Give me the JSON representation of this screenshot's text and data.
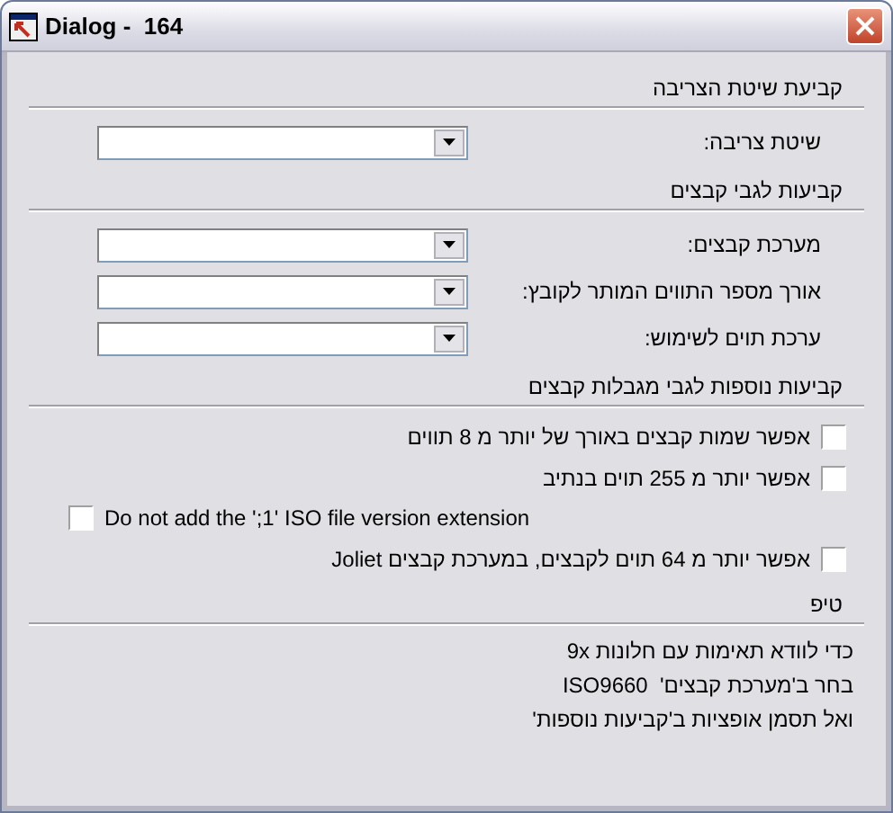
{
  "window": {
    "title": "Dialog -  164"
  },
  "sections": [
    {
      "heading": "קביעת שיטת הצריבה",
      "kind": "combos",
      "items": [
        {
          "label": "שיטת צריבה:"
        }
      ]
    },
    {
      "heading": "קביעות לגבי קבצים",
      "kind": "combos",
      "items": [
        {
          "label": "מערכת קבצים:"
        },
        {
          "label": "אורך מספר התווים המותר לקובץ:"
        },
        {
          "label": "ערכת תוים לשימוש:"
        }
      ]
    },
    {
      "heading": "קביעות נוספות לגבי מגבלות קבצים",
      "kind": "checks",
      "items": [
        {
          "label": "אפשר שמות קבצים באורך של יותר מ 8 תווים",
          "checked": false,
          "kind": "rtl"
        },
        {
          "label": "אפשר יותר מ 255 תוים בנתיב",
          "checked": false,
          "kind": "rtl"
        },
        {
          "label": "Do not add the ';1' ISO file version extension",
          "checked": false,
          "kind": "ltr"
        },
        {
          "label": "אפשר יותר מ 64 תוים לקבצים, במערכת קבצים Joliet",
          "checked": false,
          "kind": "rtl"
        }
      ]
    },
    {
      "heading": "טיפ",
      "kind": "notes",
      "items": [
        {
          "text": "כדי לוודא תאימות עם חלונות 9x"
        },
        {
          "text": "בחר ב'מערכת קבצים'  ISO9660"
        },
        {
          "text": "ואל תסמן אופציות ב'קביעות נוספות'"
        }
      ]
    }
  ]
}
